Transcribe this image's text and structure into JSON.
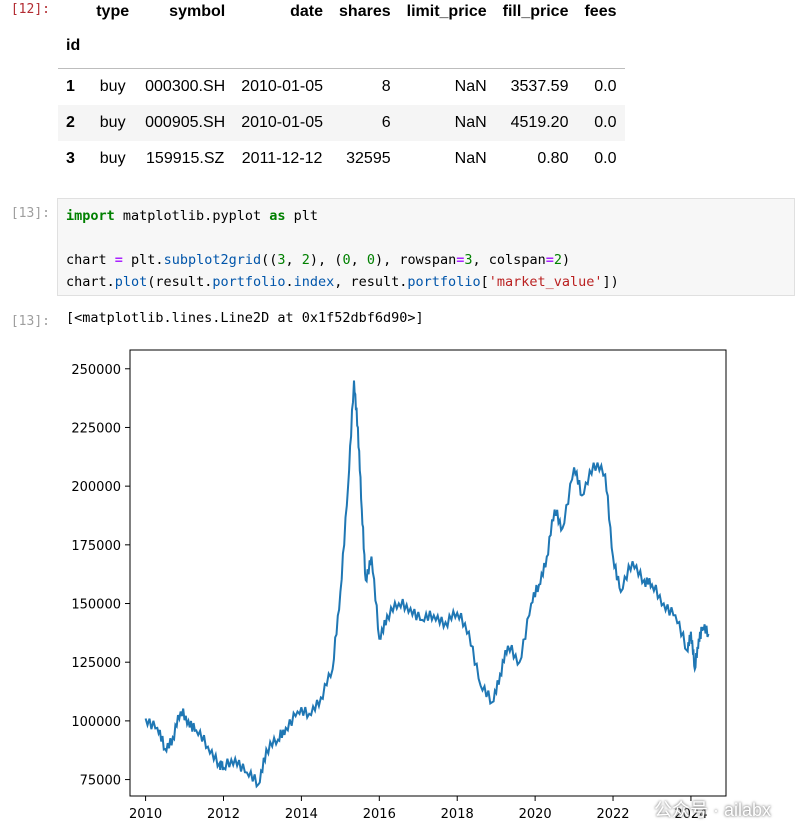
{
  "cells": {
    "out12_prompt": "[12]:",
    "in13_prompt": "[13]:",
    "out13_prompt": "[13]:"
  },
  "dataframe": {
    "columns": [
      "type",
      "symbol",
      "date",
      "shares",
      "limit_price",
      "fill_price",
      "fees"
    ],
    "index_name": "id",
    "rows": [
      {
        "id": "1",
        "type": "buy",
        "symbol": "000300.SH",
        "date": "2010-01-05",
        "shares": "8",
        "limit_price": "NaN",
        "fill_price": "3537.59",
        "fees": "0.0"
      },
      {
        "id": "2",
        "type": "buy",
        "symbol": "000905.SH",
        "date": "2010-01-05",
        "shares": "6",
        "limit_price": "NaN",
        "fill_price": "4519.20",
        "fees": "0.0"
      },
      {
        "id": "3",
        "type": "buy",
        "symbol": "159915.SZ",
        "date": "2011-12-12",
        "shares": "32595",
        "limit_price": "NaN",
        "fill_price": "0.80",
        "fees": "0.0"
      }
    ]
  },
  "code": {
    "line1": {
      "kw_import": "import",
      "module": " matplotlib.pyplot ",
      "kw_as": "as",
      "alias": " plt"
    },
    "line3": {
      "a": "chart ",
      "eq": "=",
      "b": " plt.",
      "fn": "subplot2grid",
      "c": "((",
      "n3": "3",
      "d": ", ",
      "n2": "2",
      "e": "), (",
      "n0a": "0",
      "f": ", ",
      "n0b": "0",
      "g": "), rowspan",
      "eq2": "=",
      "n3b": "3",
      "h": ", colspan",
      "eq3": "=",
      "n2b": "2",
      "i": ")"
    },
    "line4": {
      "a": "chart.",
      "fn": "plot",
      "b": "(result.",
      "fn2": "portfolio",
      "c": ".",
      "fn3": "index",
      "d": ", result.",
      "fn4": "portfolio",
      "e": "[",
      "str": "'market_value'",
      "f": "])"
    }
  },
  "output_text": "[<matplotlib.lines.Line2D at 0x1f52dbf6d90>]",
  "watermark": {
    "text": "公众号 · ailabx",
    "icon": "wechat-icon"
  },
  "chart_data": {
    "type": "line",
    "title": "",
    "xlabel": "",
    "ylabel": "",
    "color": "#1f77b4",
    "xlim": [
      2009.6,
      2024.9
    ],
    "ylim": [
      68000,
      258000
    ],
    "xticks": [
      2010,
      2012,
      2014,
      2016,
      2018,
      2020,
      2022,
      2024
    ],
    "yticks": [
      75000,
      100000,
      125000,
      150000,
      175000,
      200000,
      225000,
      250000
    ],
    "xtick_labels": [
      "2010",
      "2012",
      "2014",
      "2016",
      "2018",
      "2020",
      "2022",
      "2024"
    ],
    "ytick_labels": [
      "75000",
      "100000",
      "125000",
      "150000",
      "175000",
      "200000",
      "225000",
      "250000"
    ],
    "series": [
      {
        "x": [
          2010.0,
          2010.3,
          2010.5,
          2010.7,
          2010.9,
          2011.1,
          2011.3,
          2011.6,
          2011.9,
          2012.0,
          2012.3,
          2012.6,
          2012.9,
          2013.1,
          2013.4,
          2013.6,
          2013.9,
          2014.2,
          2014.5,
          2014.8,
          2015.0,
          2015.2,
          2015.35,
          2015.45,
          2015.55,
          2015.65,
          2015.8,
          2016.0,
          2016.2,
          2016.5,
          2016.8,
          2017.1,
          2017.4,
          2017.7,
          2018.0,
          2018.3,
          2018.6,
          2018.9,
          2019.1,
          2019.3,
          2019.6,
          2019.9,
          2020.1,
          2020.3,
          2020.5,
          2020.7,
          2021.0,
          2021.2,
          2021.5,
          2021.8,
          2022.0,
          2022.2,
          2022.5,
          2022.8,
          2023.0,
          2023.3,
          2023.6,
          2023.9,
          2024.0,
          2024.1,
          2024.2,
          2024.3,
          2024.45
        ],
        "y": [
          101000,
          97000,
          88000,
          93000,
          104000,
          100000,
          96000,
          89000,
          82000,
          80000,
          84000,
          78000,
          73000,
          88000,
          92000,
          97000,
          104000,
          103000,
          110000,
          122000,
          155000,
          200000,
          245000,
          225000,
          190000,
          160000,
          170000,
          135000,
          145000,
          150000,
          148000,
          143000,
          145000,
          142000,
          146000,
          138000,
          115000,
          108000,
          120000,
          132000,
          125000,
          150000,
          158000,
          170000,
          190000,
          182000,
          208000,
          196000,
          210000,
          205000,
          170000,
          155000,
          168000,
          160000,
          158000,
          150000,
          145000,
          130000,
          138000,
          122000,
          135000,
          140000,
          137000
        ]
      }
    ]
  }
}
